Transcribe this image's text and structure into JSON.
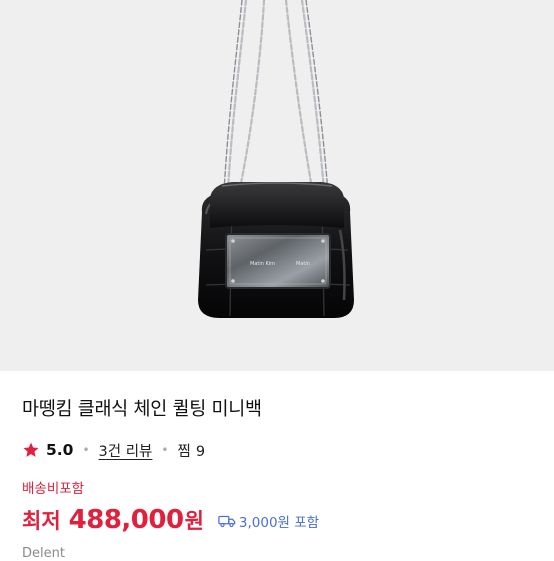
{
  "product": {
    "title": "마뗑킴 클래식 체인 퀼팅 미니백",
    "plate_text_left": "Matin Kim",
    "plate_text_right": "Matin"
  },
  "rating": {
    "score": "5.0",
    "reviews_label": "3건 리뷰",
    "likes_label": "찜",
    "likes_count": "9"
  },
  "shipping": {
    "free_label": "배송비포함",
    "fee_label": "3,000원 포함"
  },
  "price": {
    "prefix": "최저",
    "value": "488,000",
    "unit": "원"
  },
  "seller": {
    "name": "Delent"
  },
  "colors": {
    "accent_red": "#e0213d",
    "shipping_blue": "#4a6fd8",
    "hero_bg": "#efefef"
  },
  "icons": {
    "rating": "star-icon",
    "shipping": "truck-icon"
  }
}
